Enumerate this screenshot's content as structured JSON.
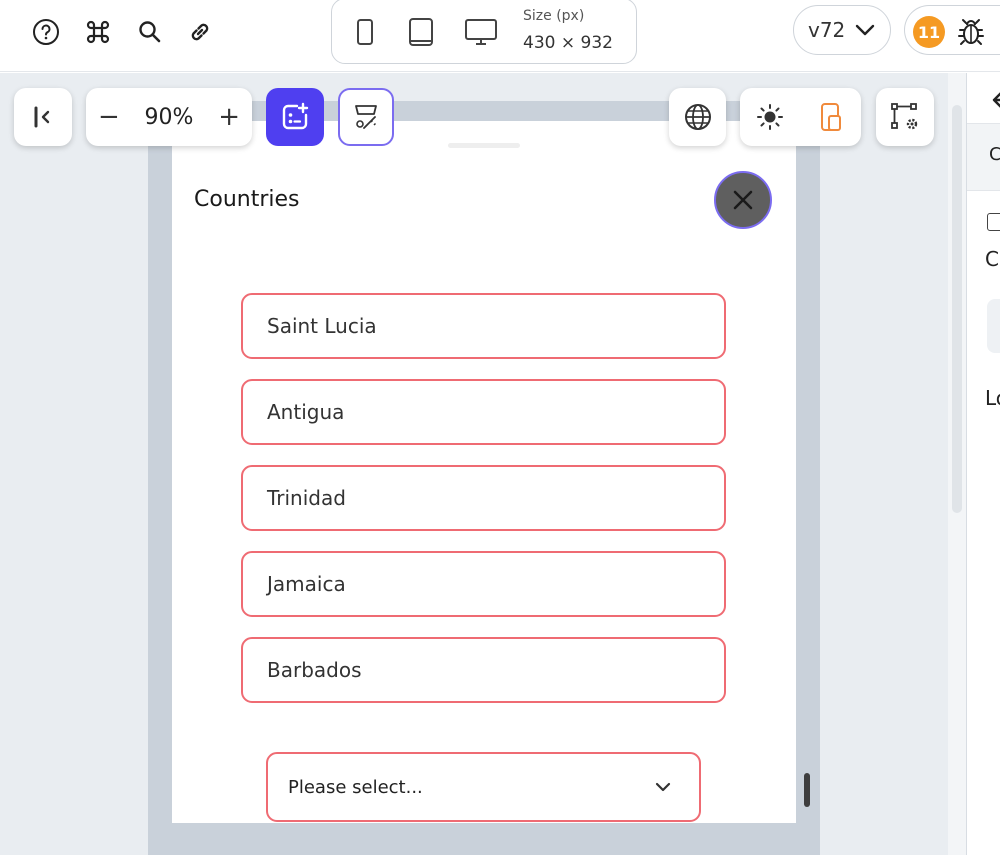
{
  "topbar": {
    "icons": [
      "help-circle-icon",
      "command-icon",
      "search-icon",
      "link-icon"
    ],
    "device": {
      "options": [
        "phone-icon",
        "tablet-icon",
        "desktop-icon"
      ],
      "size_label": "Size (px)",
      "size_value": "430 × 932"
    },
    "version": "v72",
    "bug_count": "11"
  },
  "canvas_toolbar": {
    "zoom": "90%",
    "zoom_minus": "−",
    "zoom_plus": "+"
  },
  "sheet": {
    "title": "Countries",
    "countries": [
      "Saint Lucia",
      "Antigua",
      "Trinidad",
      "Jamaica",
      "Barbados"
    ],
    "select_placeholder": "Please select..."
  },
  "right_panel": {
    "tab_letter": "C",
    "text_1": "C",
    "text_2": "Lo"
  },
  "colors": {
    "accent": "#4f3ff0",
    "field_border": "#ef6b73",
    "badge": "#f59a23",
    "canvas_bg": "#e9edf1"
  }
}
